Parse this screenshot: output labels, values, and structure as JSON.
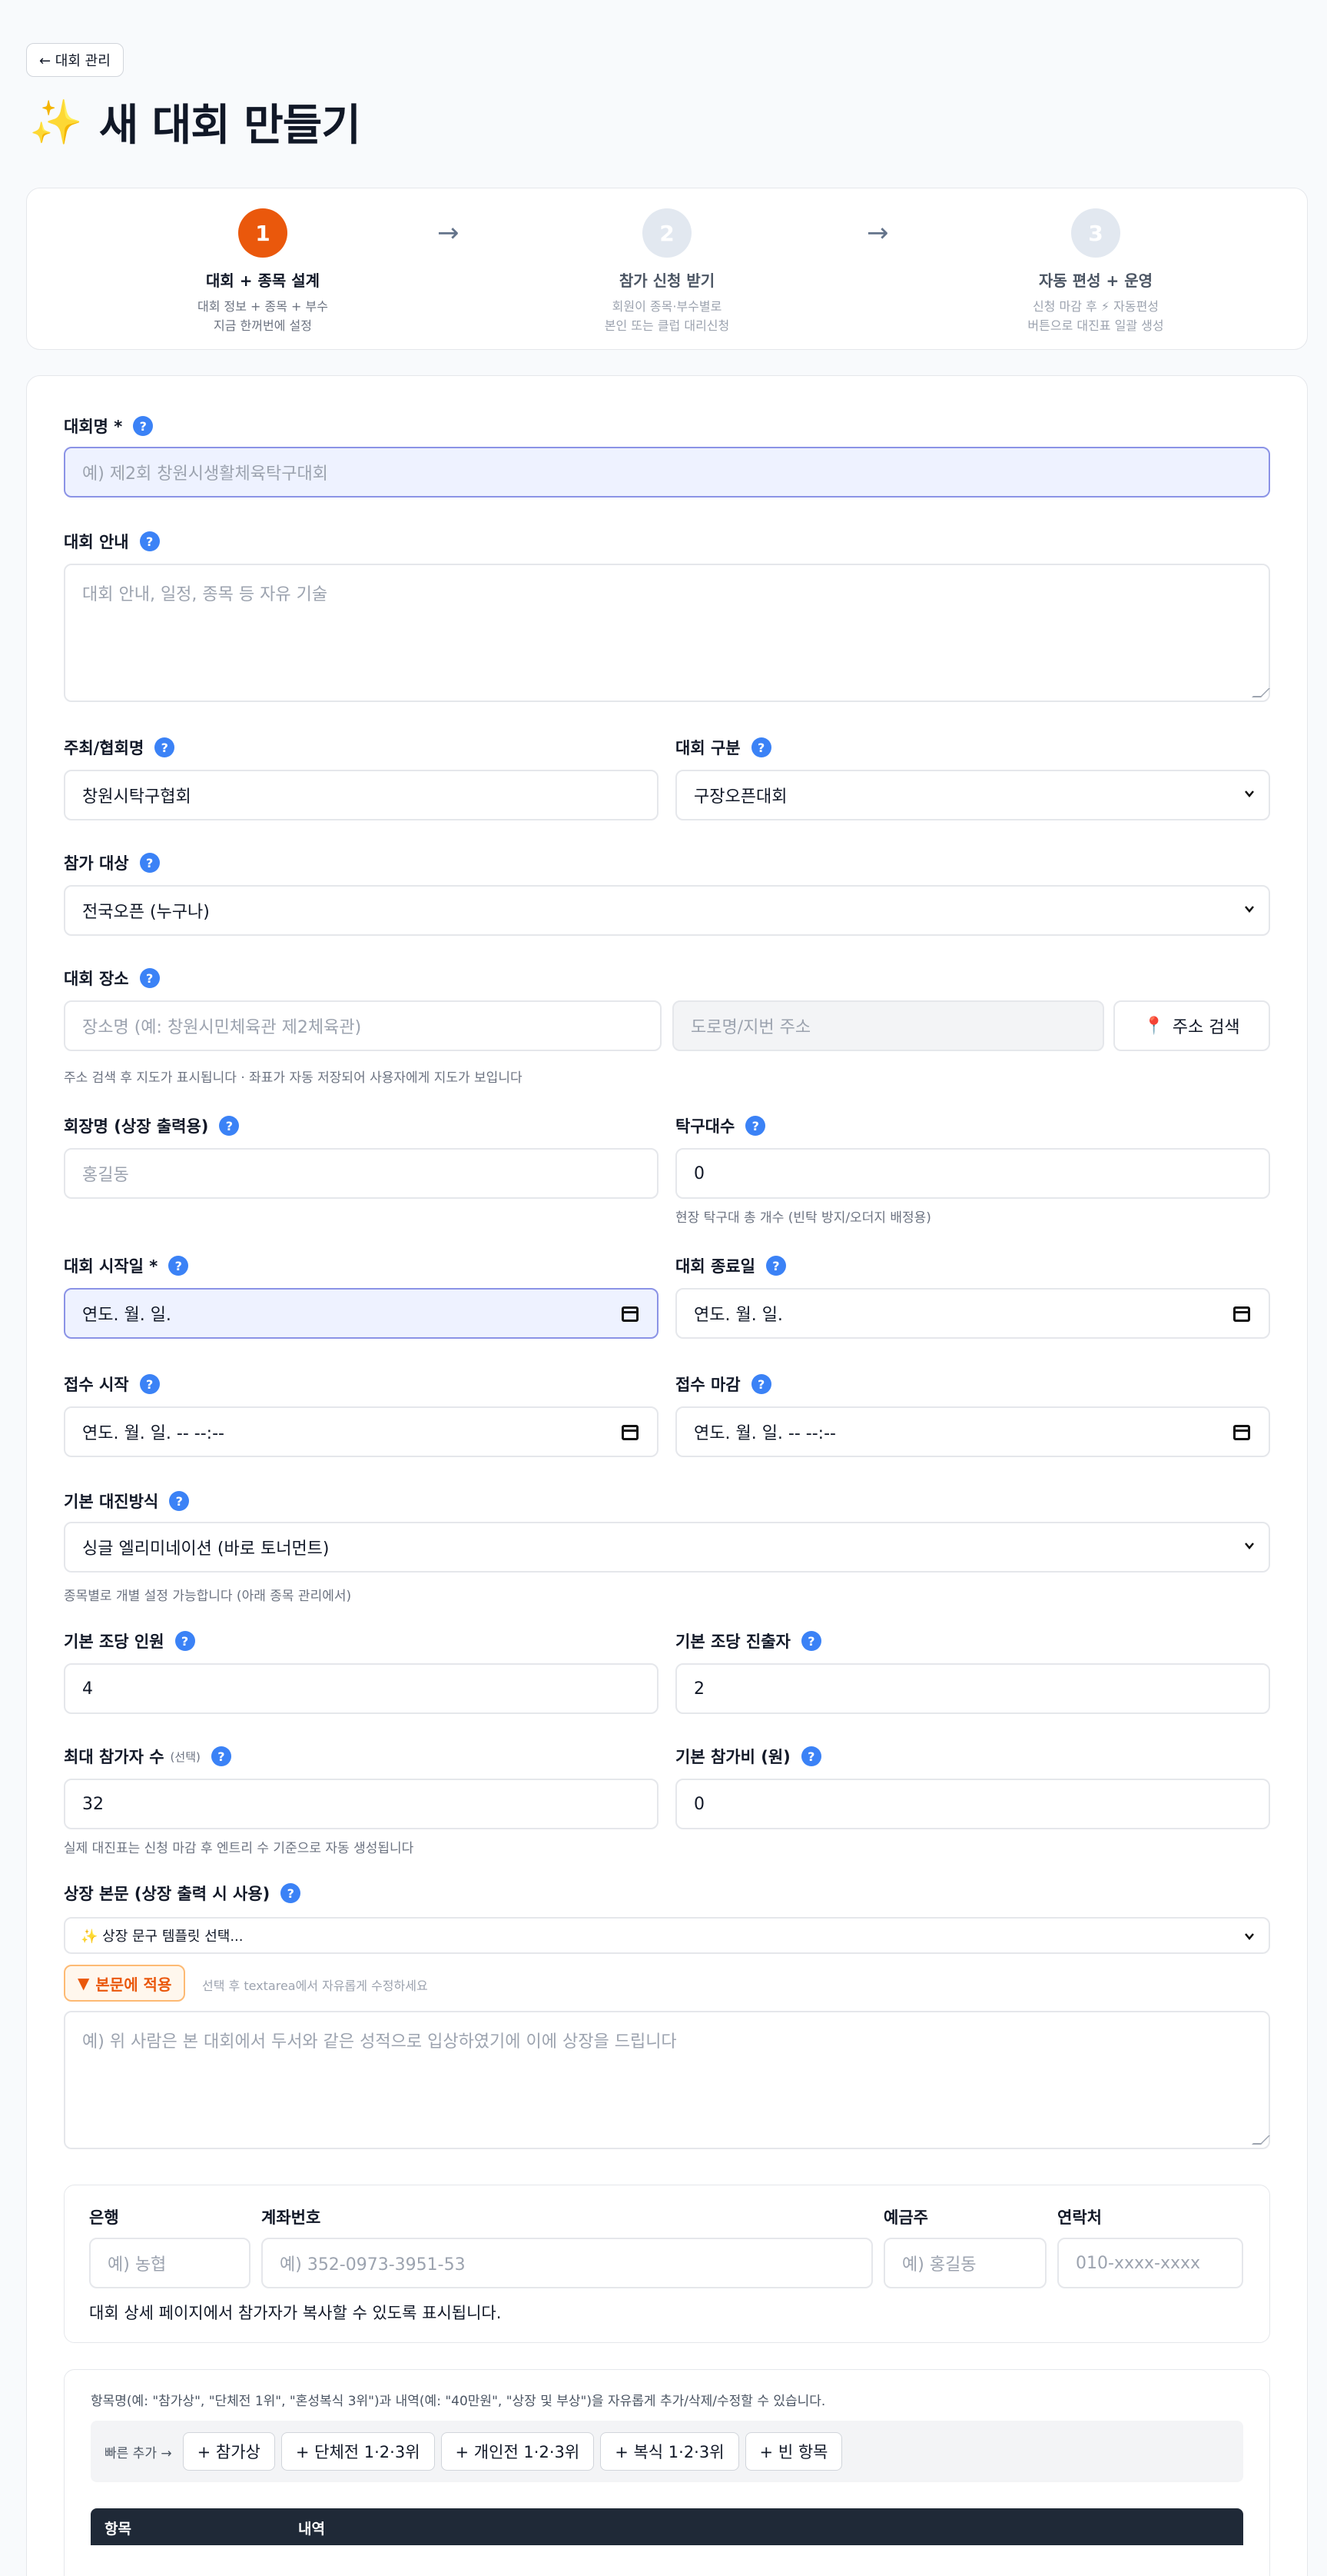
{
  "header": {
    "back_label": "← 대회 관리",
    "title": "새 대회 만들기"
  },
  "steps": [
    {
      "num": "1",
      "title": "대회 + 종목 설계",
      "desc1": "대회 정보 + 종목 + 부수",
      "desc2": "지금 한꺼번에 설정"
    },
    {
      "num": "2",
      "title": "참가 신청 받기",
      "desc1": "회원이 종목·부수별로",
      "desc2": "본인 또는 클럽 대리신청"
    },
    {
      "num": "3",
      "title": "자동 편성 + 운영",
      "desc1": "신청 마감 후 ⚡ 자동편성",
      "desc2": "버튼으로 대진표 일괄 생성"
    }
  ],
  "form": {
    "name_label": "대회명 *",
    "name_placeholder": "예) 제2회 창원시생활체육탁구대회",
    "intro_label": "대회 안내",
    "intro_placeholder": "대회 안내, 일정, 종목 등 자유 기술",
    "host_label": "주최/협회명",
    "host_value": "창원시탁구협회",
    "category_label": "대회 구분",
    "category_value": "구장오픈대회",
    "target_label": "참가 대상",
    "target_value": "전국오픈 (누구나)",
    "venue_label": "대회 장소",
    "venue_placeholder": "장소명 (예: 창원시민체육관 제2체육관)",
    "address_placeholder": "도로명/지번 주소",
    "address_button": "주소 검색",
    "venue_hint": "주소 검색 후 지도가 표시됩니다 · 좌표가 자동 저장되어 사용자에게 지도가 보입니다",
    "chair_label": "회장명 (상장 출력용)",
    "chair_placeholder": "홍길동",
    "tables_label": "탁구대수",
    "tables_value": "0",
    "tables_hint": "현장 탁구대 총 개수 (빈탁 방지/오더지 배정용)",
    "start_label": "대회 시작일 *",
    "start_value": "연도. 월. 일.",
    "end_label": "대회 종료일",
    "end_value": "연도. 월. 일.",
    "reg_start_label": "접수 시작",
    "reg_start_value": "연도. 월. 일. -- --:--",
    "reg_end_label": "접수 마감",
    "reg_end_value": "연도. 월. 일. -- --:--",
    "format_label": "기본 대진방식",
    "format_value": "싱글 엘리미네이션 (바로 토너먼트)",
    "format_hint": "종목별로 개별 설정 가능합니다 (아래 종목 관리에서)",
    "group_size_label": "기본 조당 인원",
    "group_size_value": "4",
    "advance_label": "기본 조당 진출자",
    "advance_value": "2",
    "max_label": "최대 참가자 수",
    "max_sub": "(선택)",
    "max_value": "32",
    "fee_label": "기본 참가비 (원)",
    "fee_value": "0",
    "max_hint": "실제 대진표는 신청 마감 후 엔트리 수 기준으로 자동 생성됩니다",
    "award_label": "상장 본문 (상장 출력 시 사용)",
    "award_template": "✨ 상장 문구 템플릿 선택...",
    "apply_button": "본문에 적용",
    "apply_hint": "선택 후 textarea에서 자유롭게 수정하세요",
    "award_placeholder": "예) 위 사람은 본 대회에서 두서와 같은 성적으로 입상하였기에 이에 상장을 드립니다"
  },
  "bank": {
    "bank_label": "은행",
    "bank_placeholder": "예) 농협",
    "account_label": "계좌번호",
    "account_placeholder": "예) 352-0973-3951-53",
    "holder_label": "예금주",
    "holder_placeholder": "예) 홍길동",
    "contact_label": "연락처",
    "contact_placeholder": "010-xxxx-xxxx",
    "note": "대회 상세 페이지에서 참가자가 복사할 수 있도록 표시됩니다."
  },
  "prizes": {
    "desc": "항목명(예: \"참가상\", \"단체전 1위\", \"혼성복식 3위\")과 내역(예: \"40만원\", \"상장 및 부상\")을 자유롭게 추가/삭제/수정할 수 있습니다.",
    "quick_label": "빠른 추가 →",
    "chips": [
      "+ 참가상",
      "+ 단체전 1·2·3위",
      "+ 개인전 1·2·3위",
      "+ 복식 1·2·3위",
      "+ 빈 항목"
    ],
    "col_item": "항목",
    "col_detail": "내역"
  },
  "colors": {
    "accent": "#ea580c",
    "help": "#3b82f6",
    "inactive_step": "#e2e8f0",
    "table_head": "#1f2937"
  }
}
